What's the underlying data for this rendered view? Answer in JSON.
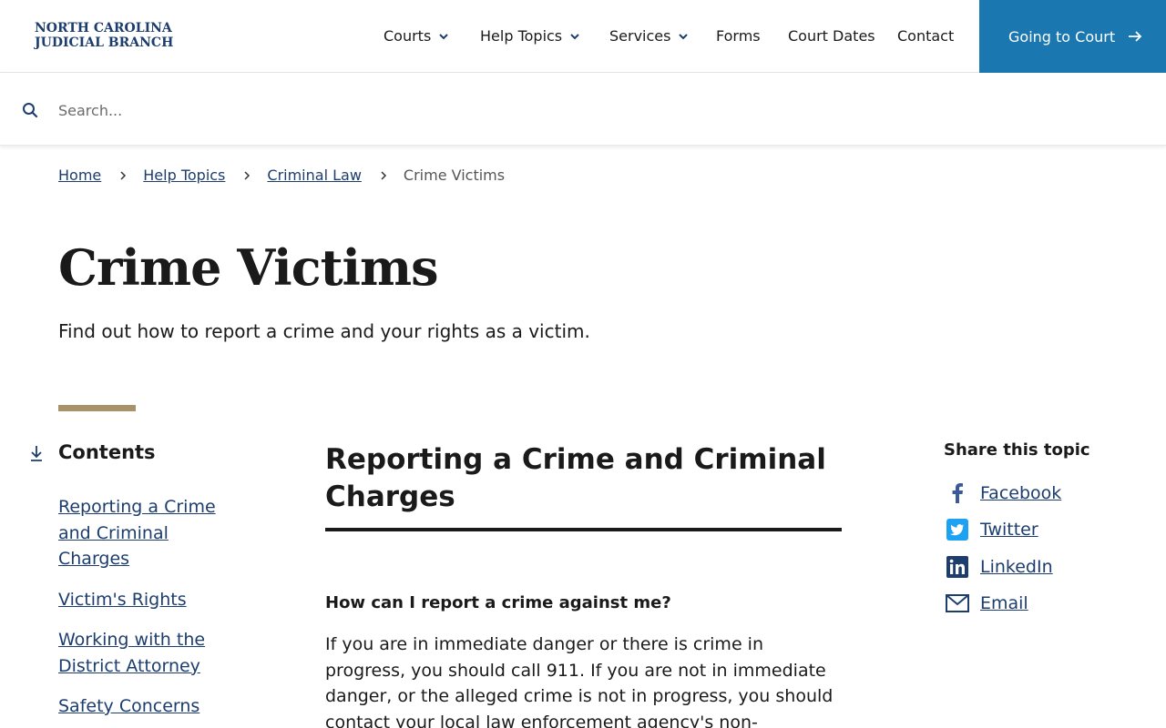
{
  "header": {
    "logo_line1": "NORTH CAROLINA",
    "logo_line2": "JUDICIAL BRANCH",
    "nav": [
      {
        "label": "Courts",
        "has_dropdown": true
      },
      {
        "label": "Help Topics",
        "has_dropdown": true
      },
      {
        "label": "Services",
        "has_dropdown": true
      },
      {
        "label": "Forms",
        "has_dropdown": false
      },
      {
        "label": "Court Dates",
        "has_dropdown": false
      },
      {
        "label": "Contact",
        "has_dropdown": false
      }
    ],
    "cta_label": "Going to Court",
    "cta_color": "#1a77b0"
  },
  "search": {
    "placeholder": "Search..."
  },
  "breadcrumb": {
    "items": [
      "Home",
      "Help Topics",
      "Criminal Law"
    ],
    "current": "Crime Victims"
  },
  "page": {
    "title": "Crime Victims",
    "subtitle": "Find out how to report a crime and your rights as a victim.",
    "accent_color": "#a8926a"
  },
  "contents": {
    "title": "Contents",
    "items": [
      "Reporting a Crime and Criminal Charges",
      "Victim's Rights",
      "Working with the District Attorney",
      "Safety Concerns"
    ]
  },
  "main": {
    "section_title": "Reporting a Crime and Criminal Charges",
    "question": "How can I report a crime against me?",
    "body": "If you are in immediate danger or there is crime in progress, you should call 911. If you are not in immediate danger, or the alleged crime is not in progress, you should contact your local law enforcement agency's non-emergency number in order to"
  },
  "share": {
    "title": "Share this topic",
    "items": [
      {
        "label": "Facebook",
        "icon": "facebook-icon"
      },
      {
        "label": "Twitter",
        "icon": "twitter-icon"
      },
      {
        "label": "LinkedIn",
        "icon": "linkedin-icon"
      },
      {
        "label": "Email",
        "icon": "email-icon"
      }
    ]
  }
}
